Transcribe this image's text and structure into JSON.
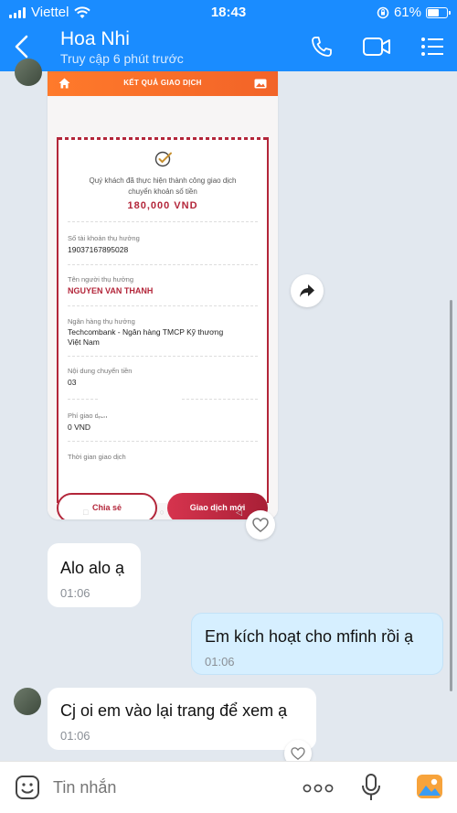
{
  "status_bar": {
    "carrier": "Viettel",
    "time": "18:43",
    "battery": "61%",
    "battery_level": 0.61
  },
  "header": {
    "title": "Hoa Nhi",
    "subtitle": "Truy cập 6 phút trước"
  },
  "receipt": {
    "screen_title": "KẾT QUẢ GIAO DỊCH",
    "message": "Quý khách đã thực hiện thành công giao dịch chuyển khoản số tiền",
    "amount": "180,000 VND",
    "fields": [
      {
        "label": "Số tài khoản thụ hưởng",
        "value": "19037167895028"
      },
      {
        "label": "Tên người thụ hưởng",
        "value": "NGUYEN VAN THANH"
      },
      {
        "label": "Ngân hàng thụ hưởng",
        "value": "Techcombank - Ngân hàng TMCP Kỹ thương Việt Nam"
      },
      {
        "label": "Nội dung chuyển tiền",
        "value": "03"
      },
      {
        "label": "Phí giao dịch",
        "value": "0 VND"
      },
      {
        "label": "Thời gian giao dịch",
        "value": ""
      }
    ],
    "btn_share": "Chia sẻ",
    "btn_new": "Giao dịch mới"
  },
  "messages": [
    {
      "direction": "in",
      "text": "Alo alo ạ",
      "time": "01:06"
    },
    {
      "direction": "out",
      "text": "Em kích hoạt cho mfinh rồi ạ",
      "time": "01:06"
    },
    {
      "direction": "in",
      "text": "Cj oi em vào lại trang để xem ạ",
      "time": "01:06"
    }
  ],
  "composer": {
    "placeholder": "Tin nhắn"
  },
  "colors": {
    "header": "#1a8cff",
    "brand_red": "#b3263a",
    "out_bubble": "#d6efff"
  }
}
